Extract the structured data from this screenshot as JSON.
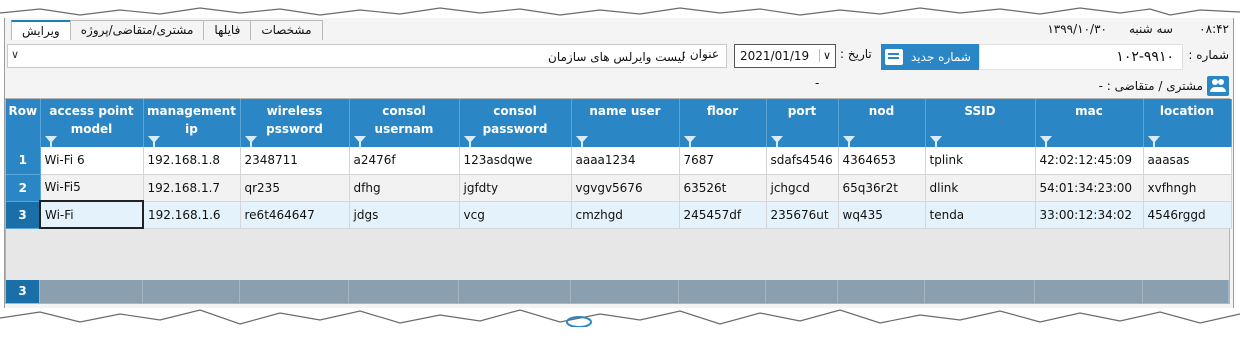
{
  "status": {
    "clock": "۰۸:۴۲",
    "day": "سه شنبه",
    "date": "۱۳۹۹/۱۰/۳۰"
  },
  "tabs": [
    {
      "label": "ویرایش"
    },
    {
      "label": "مشتری/متقاضی/پروژه"
    },
    {
      "label": "فایلها"
    },
    {
      "label": "مشخصات"
    }
  ],
  "form": {
    "number_label": "شماره :",
    "number_value": "۱۰۲-۹۹۱۰",
    "new_number_button": "شماره جدید",
    "date_label": "تاریخ :",
    "date_value": "2021/01/19",
    "subject_label": "عنوان :",
    "subject_value": "لیست وایرلس های سازمان",
    "customer_label": "مشتری / متقاضی :  -",
    "customer_dash": "-"
  },
  "grid": {
    "columns": [
      {
        "l1": "Row",
        "l2": ""
      },
      {
        "l1": "access point",
        "l2": "model"
      },
      {
        "l1": "management",
        "l2": "ip"
      },
      {
        "l1": "wireless",
        "l2": "pssword"
      },
      {
        "l1": "consol",
        "l2": "usernam"
      },
      {
        "l1": "consol",
        "l2": "password"
      },
      {
        "l1": "name user",
        "l2": ""
      },
      {
        "l1": "floor",
        "l2": ""
      },
      {
        "l1": "port",
        "l2": ""
      },
      {
        "l1": "nod",
        "l2": ""
      },
      {
        "l1": "SSID",
        "l2": ""
      },
      {
        "l1": "mac",
        "l2": ""
      },
      {
        "l1": "location",
        "l2": ""
      }
    ],
    "rows": [
      {
        "row": "1",
        "cells": [
          "Wi-Fi 6",
          "192.168.1.8",
          "2348711",
          "a2476f",
          "123asdqwe",
          "aaaa1234",
          "7687",
          "sdafs4546",
          "4364653",
          "tplink",
          "42:02:12:45:09",
          "aaasas"
        ]
      },
      {
        "row": "2",
        "cells": [
          "Wi-Fi5",
          "192.168.1.7",
          "qr235",
          "dfhg",
          "jgfdty",
          "vgvgv5676",
          "63526t",
          "jchgcd",
          "65q36r2t",
          "dlink",
          "54:01:34:23:00",
          "xvfhngh"
        ]
      },
      {
        "row": "3",
        "cells": [
          "Wi-Fi",
          "192.168.1.6",
          "re6t464647",
          "jdgs",
          "vcg",
          "cmzhgd",
          "245457df",
          "235676ut",
          "wq435",
          "tenda",
          "33:00:12:34:02",
          "4546rggd"
        ]
      }
    ],
    "footer_count": "3"
  },
  "colors": {
    "header_blue": "#2a86c4",
    "selected_row": "#e4f3fb",
    "footer_gray": "#8aa0b0"
  }
}
